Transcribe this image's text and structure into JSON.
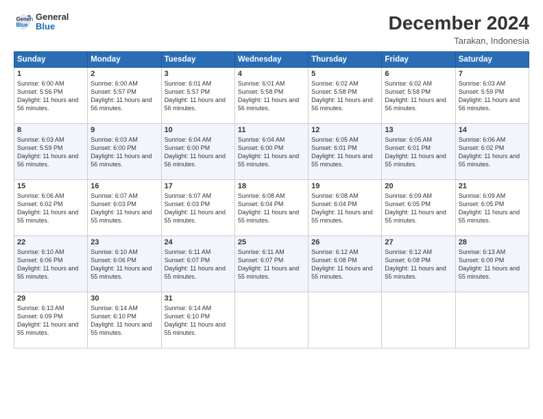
{
  "header": {
    "logo_line1": "General",
    "logo_line2": "Blue",
    "month_year": "December 2024",
    "location": "Tarakan, Indonesia"
  },
  "weekdays": [
    "Sunday",
    "Monday",
    "Tuesday",
    "Wednesday",
    "Thursday",
    "Friday",
    "Saturday"
  ],
  "weeks": [
    [
      {
        "day": "1",
        "rise": "Sunrise: 6:00 AM",
        "set": "Sunset: 5:56 PM",
        "daylight": "Daylight: 11 hours and 56 minutes."
      },
      {
        "day": "2",
        "rise": "Sunrise: 6:00 AM",
        "set": "Sunset: 5:57 PM",
        "daylight": "Daylight: 11 hours and 56 minutes."
      },
      {
        "day": "3",
        "rise": "Sunrise: 6:01 AM",
        "set": "Sunset: 5:57 PM",
        "daylight": "Daylight: 11 hours and 56 minutes."
      },
      {
        "day": "4",
        "rise": "Sunrise: 6:01 AM",
        "set": "Sunset: 5:58 PM",
        "daylight": "Daylight: 11 hours and 56 minutes."
      },
      {
        "day": "5",
        "rise": "Sunrise: 6:02 AM",
        "set": "Sunset: 5:58 PM",
        "daylight": "Daylight: 11 hours and 56 minutes."
      },
      {
        "day": "6",
        "rise": "Sunrise: 6:02 AM",
        "set": "Sunset: 5:58 PM",
        "daylight": "Daylight: 11 hours and 56 minutes."
      },
      {
        "day": "7",
        "rise": "Sunrise: 6:03 AM",
        "set": "Sunset: 5:59 PM",
        "daylight": "Daylight: 11 hours and 56 minutes."
      }
    ],
    [
      {
        "day": "8",
        "rise": "Sunrise: 6:03 AM",
        "set": "Sunset: 5:59 PM",
        "daylight": "Daylight: 11 hours and 56 minutes."
      },
      {
        "day": "9",
        "rise": "Sunrise: 6:03 AM",
        "set": "Sunset: 6:00 PM",
        "daylight": "Daylight: 11 hours and 56 minutes."
      },
      {
        "day": "10",
        "rise": "Sunrise: 6:04 AM",
        "set": "Sunset: 6:00 PM",
        "daylight": "Daylight: 11 hours and 56 minutes."
      },
      {
        "day": "11",
        "rise": "Sunrise: 6:04 AM",
        "set": "Sunset: 6:00 PM",
        "daylight": "Daylight: 11 hours and 55 minutes."
      },
      {
        "day": "12",
        "rise": "Sunrise: 6:05 AM",
        "set": "Sunset: 6:01 PM",
        "daylight": "Daylight: 11 hours and 55 minutes."
      },
      {
        "day": "13",
        "rise": "Sunrise: 6:05 AM",
        "set": "Sunset: 6:01 PM",
        "daylight": "Daylight: 11 hours and 55 minutes."
      },
      {
        "day": "14",
        "rise": "Sunrise: 6:06 AM",
        "set": "Sunset: 6:02 PM",
        "daylight": "Daylight: 11 hours and 55 minutes."
      }
    ],
    [
      {
        "day": "15",
        "rise": "Sunrise: 6:06 AM",
        "set": "Sunset: 6:02 PM",
        "daylight": "Daylight: 11 hours and 55 minutes."
      },
      {
        "day": "16",
        "rise": "Sunrise: 6:07 AM",
        "set": "Sunset: 6:03 PM",
        "daylight": "Daylight: 11 hours and 55 minutes."
      },
      {
        "day": "17",
        "rise": "Sunrise: 6:07 AM",
        "set": "Sunset: 6:03 PM",
        "daylight": "Daylight: 11 hours and 55 minutes."
      },
      {
        "day": "18",
        "rise": "Sunrise: 6:08 AM",
        "set": "Sunset: 6:04 PM",
        "daylight": "Daylight: 11 hours and 55 minutes."
      },
      {
        "day": "19",
        "rise": "Sunrise: 6:08 AM",
        "set": "Sunset: 6:04 PM",
        "daylight": "Daylight: 11 hours and 55 minutes."
      },
      {
        "day": "20",
        "rise": "Sunrise: 6:09 AM",
        "set": "Sunset: 6:05 PM",
        "daylight": "Daylight: 11 hours and 55 minutes."
      },
      {
        "day": "21",
        "rise": "Sunrise: 6:09 AM",
        "set": "Sunset: 6:05 PM",
        "daylight": "Daylight: 11 hours and 55 minutes."
      }
    ],
    [
      {
        "day": "22",
        "rise": "Sunrise: 6:10 AM",
        "set": "Sunset: 6:06 PM",
        "daylight": "Daylight: 11 hours and 55 minutes."
      },
      {
        "day": "23",
        "rise": "Sunrise: 6:10 AM",
        "set": "Sunset: 6:06 PM",
        "daylight": "Daylight: 11 hours and 55 minutes."
      },
      {
        "day": "24",
        "rise": "Sunrise: 6:11 AM",
        "set": "Sunset: 6:07 PM",
        "daylight": "Daylight: 11 hours and 55 minutes."
      },
      {
        "day": "25",
        "rise": "Sunrise: 6:11 AM",
        "set": "Sunset: 6:07 PM",
        "daylight": "Daylight: 11 hours and 55 minutes."
      },
      {
        "day": "26",
        "rise": "Sunrise: 6:12 AM",
        "set": "Sunset: 6:08 PM",
        "daylight": "Daylight: 11 hours and 55 minutes."
      },
      {
        "day": "27",
        "rise": "Sunrise: 6:12 AM",
        "set": "Sunset: 6:08 PM",
        "daylight": "Daylight: 11 hours and 55 minutes."
      },
      {
        "day": "28",
        "rise": "Sunrise: 6:13 AM",
        "set": "Sunset: 6:09 PM",
        "daylight": "Daylight: 11 hours and 55 minutes."
      }
    ],
    [
      {
        "day": "29",
        "rise": "Sunrise: 6:13 AM",
        "set": "Sunset: 6:09 PM",
        "daylight": "Daylight: 11 hours and 55 minutes."
      },
      {
        "day": "30",
        "rise": "Sunrise: 6:14 AM",
        "set": "Sunset: 6:10 PM",
        "daylight": "Daylight: 11 hours and 55 minutes."
      },
      {
        "day": "31",
        "rise": "Sunrise: 6:14 AM",
        "set": "Sunset: 6:10 PM",
        "daylight": "Daylight: 11 hours and 55 minutes."
      },
      null,
      null,
      null,
      null
    ]
  ]
}
